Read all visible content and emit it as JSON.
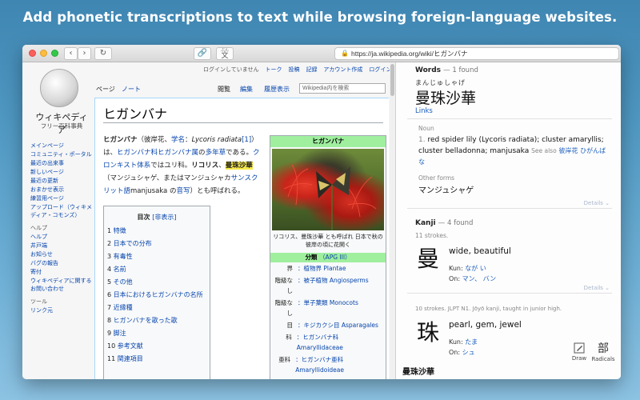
{
  "headline": "Add phonetic transcriptions to text while browsing foreign-language websites.",
  "browser": {
    "back": "‹",
    "forward": "›",
    "reload": "↻",
    "ext_link_icon": "🔗",
    "ext_dict_icon": "文",
    "ext_dict_ruby": "ぶん",
    "url": "https://ja.wikipedia.org/wiki/ヒガンバナ",
    "lock": "🔒"
  },
  "wiki": {
    "logo_name": "ウィキペディア",
    "logo_sub": "フリー百科事典",
    "user_links": [
      "ログインしていません",
      "トーク",
      "投稿",
      "記録",
      "アカウント作成",
      "ログイン"
    ],
    "tab_page": "ページ",
    "tab_note": "ノート",
    "tab_view": "閲覧",
    "tab_edit": "編集",
    "tab_history": "履歴表示",
    "search_placeholder": "Wikipedia内を検索",
    "nav": [
      "メインページ",
      "コミュニティ・ポータル",
      "最近の出来事",
      "新しいページ",
      "最近の更新",
      "おまかせ表示",
      "練習用ページ",
      "アップロード（ウィキメディア・コモンズ）"
    ],
    "help_head": "ヘルプ",
    "help": [
      "ヘルプ",
      "井戸端",
      "お知らせ",
      "バグの報告",
      "寄付",
      "ウィキペディアに関するお問い合わせ"
    ],
    "tools_head": "ツール",
    "tools": [
      "リンク元"
    ],
    "title": "ヒガンバナ",
    "intro": [
      {
        "t": "ヒガンバナ",
        "s": "b"
      },
      {
        "t": "（彼岸花、"
      },
      {
        "t": "学名",
        "s": "l"
      },
      {
        "t": "："
      },
      {
        "t": "Lycoris radiata",
        "s": "i"
      },
      {
        "t": "[1]",
        "s": "l"
      },
      {
        "t": "）は、"
      },
      {
        "t": "ヒガンバナ科",
        "s": "l"
      },
      {
        "t": "ヒガンバナ属",
        "s": "l"
      },
      {
        "t": "の"
      },
      {
        "t": "多年草",
        "s": "l"
      },
      {
        "t": "である。"
      },
      {
        "t": "クロンキスト体系",
        "s": "l"
      },
      {
        "t": "ではユリ科。"
      },
      {
        "t": "リコリス",
        "s": "b"
      },
      {
        "t": "、"
      },
      {
        "t": "曼珠沙華",
        "s": "h"
      },
      {
        "t": "（マンジュシャゲ、またはマンジュシャカ"
      },
      {
        "t": "サンスクリット語",
        "s": "l"
      },
      {
        "t": "manjusaka の"
      },
      {
        "t": "音写",
        "s": "l"
      },
      {
        "t": "）とも呼ばれる。"
      }
    ],
    "toc_title": "目次",
    "toc_toggle": "[非表示]",
    "toc": [
      {
        "n": "1",
        "t": "特徴"
      },
      {
        "n": "2",
        "t": "日本での分布"
      },
      {
        "n": "3",
        "t": "有毒性"
      },
      {
        "n": "4",
        "t": "名前"
      },
      {
        "n": "5",
        "t": "その他"
      },
      {
        "n": "6",
        "t": "日本におけるヒガンバナの名所"
      },
      {
        "n": "7",
        "t": "近縁種"
      },
      {
        "n": "8",
        "t": "ヒガンバナを歌った歌"
      },
      {
        "n": "9",
        "t": "脚注"
      },
      {
        "n": "10",
        "t": "参考文献"
      },
      {
        "n": "11",
        "t": "関連項目"
      }
    ],
    "infobox_title": "ヒガンバナ",
    "infobox_caption": "リコリス、曼珠沙華 とも呼ばれ 日本で秋の彼岸の頃に花開く",
    "infobox_class": "分類",
    "infobox_apg": "（APG III）",
    "infobox_rows": [
      {
        "k": "界",
        "v": "：植物界 Plantae"
      },
      {
        "k": "階級なし",
        "v": "：被子植物 Angiosperms"
      },
      {
        "k": "階級なし",
        "v": "：単子葉類 Monocots"
      },
      {
        "k": "目",
        "v": "：キジカクシ目 Asparagales"
      },
      {
        "k": "科",
        "v": "：ヒガンバナ科 Amaryllidaceae"
      },
      {
        "k": "亜科",
        "v": "：ヒガンバナ亜科 Amaryllidoideae"
      }
    ]
  },
  "dict": {
    "words_head": "Words",
    "words_count": "— 1 found",
    "word_reading": "まんじゅしゃげ",
    "word": "曼珠沙華",
    "links": "Links",
    "pos": "Noun",
    "sense_num": "1.",
    "sense_red": "red spider lily (Lycoris radiata); cluster amaryllis; cluster belladonna; manjusaka",
    "see_also_label": "See also",
    "see_also": "彼岸花 ひがんばな",
    "other_forms_label": "Other forms",
    "other_forms": "マンジュシャゲ",
    "details": "Details ⌄",
    "kanji_head": "Kanji",
    "kanji_count": "— 4 found",
    "kanji": [
      {
        "strokes": "11 strokes.",
        "char": "曼",
        "meaning": "wide, beautiful",
        "kun_label": "Kun:",
        "kun": "なが い",
        "on_label": "On:",
        "on": "マン、 バン"
      },
      {
        "strokes": "10 strokes. JLPT N1. Jōyō kanji, taught in junior high.",
        "char": "珠",
        "meaning": "pearl, gem, jewel",
        "kun_label": "Kun:",
        "kun": "たま",
        "on_label": "On:",
        "on": "シュ"
      }
    ],
    "footer_word": "曼珠沙華",
    "draw_label": "Draw",
    "radicals_label": "Radicals",
    "radicals_glyph": "部"
  }
}
